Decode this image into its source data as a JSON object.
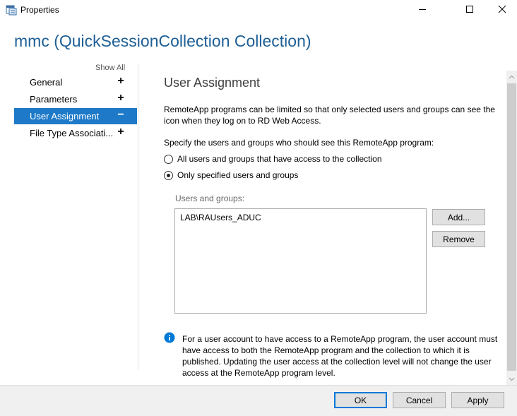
{
  "window": {
    "title": "Properties",
    "icon": "properties-app-icon"
  },
  "header": {
    "title": "mmc (QuickSessionCollection Collection)"
  },
  "nav": {
    "show_all": "Show All",
    "items": [
      {
        "label": "General",
        "sign": "+",
        "active": false
      },
      {
        "label": "Parameters",
        "sign": "+",
        "active": false
      },
      {
        "label": "User Assignment",
        "sign": "−",
        "active": true
      },
      {
        "label": "File Type Associati...",
        "sign": "+",
        "active": false
      }
    ]
  },
  "main": {
    "section_title": "User Assignment",
    "description": "RemoteApp programs can be limited so that only selected users and groups can see the icon when they log on to RD Web Access.",
    "specify_label": "Specify the users and groups who should see this RemoteApp program:",
    "radio_all": {
      "label": "All users and groups that have access to the collection",
      "checked": false
    },
    "radio_specified": {
      "label": "Only specified users and groups",
      "checked": true
    },
    "users_label": "Users and groups:",
    "users": [
      "LAB\\RAUsers_ADUC"
    ],
    "add_button": "Add...",
    "remove_button": "Remove",
    "info_text": "For a user account to have access to a RemoteApp program, the user account must have access to both the RemoteApp program and the collection to which it is published. Updating the user access at the collection level will not change the user access at the RemoteApp program level."
  },
  "footer": {
    "ok": "OK",
    "cancel": "Cancel",
    "apply": "Apply"
  },
  "colors": {
    "accent": "#1e7ac8",
    "header_title": "#1e5f96",
    "info_icon": "#0078d7"
  }
}
